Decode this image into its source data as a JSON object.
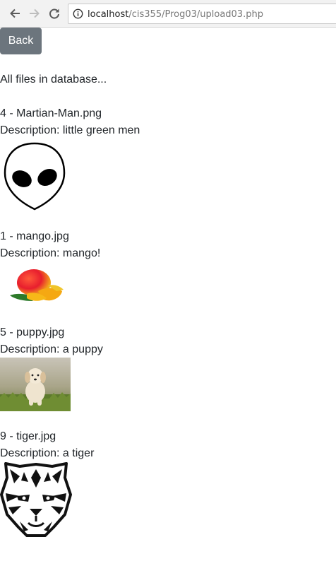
{
  "browser": {
    "url_host": "localhost",
    "url_path": "/cis355/Prog03/upload03.php"
  },
  "page": {
    "back_label": "Back",
    "heading": "All files in database...",
    "files": [
      {
        "title": "4 - Martian-Man.png",
        "description": "Description: little green men",
        "image": "alien-head-icon"
      },
      {
        "title": "1 - mango.jpg",
        "description": "Description: mango!",
        "image": "mango-image"
      },
      {
        "title": "5 - puppy.jpg",
        "description": "Description: a puppy",
        "image": "puppy-photo"
      },
      {
        "title": "9 - tiger.jpg",
        "description": "Description: a tiger",
        "image": "tiger-head-icon"
      }
    ]
  },
  "colors": {
    "back_button": "#6c757d",
    "text": "#212529"
  }
}
